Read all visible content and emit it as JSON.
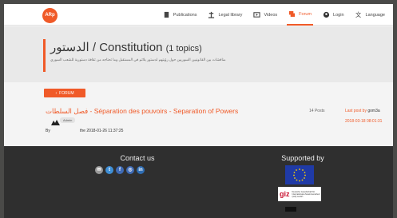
{
  "app": {
    "logo_text": "ARp"
  },
  "nav": {
    "items": [
      {
        "label": "Publications",
        "icon": "book-icon"
      },
      {
        "label": "Legal library",
        "icon": "scales-icon"
      },
      {
        "label": "Videos",
        "icon": "video-icon"
      },
      {
        "label": "Forum",
        "icon": "chat-icon",
        "active": true
      },
      {
        "label": "Login",
        "icon": "user-icon"
      },
      {
        "label": "Language",
        "icon": "translate-icon"
      }
    ]
  },
  "header": {
    "title_ar": "الدستور",
    "title_sep": " / ",
    "title_en": "Constitution",
    "topics": "(1 topics)",
    "subtitle": "مناقشات بين القانونيين السوريين حول رؤيتهم لدستور يلائم في المستقبل وما تحتاجه من ثقافة دستورية للشعب السوري"
  },
  "main": {
    "forum_button": "FORUM",
    "topic": {
      "title": "فصل السلطات - Séparation des pouvoirs - Separation of Powers",
      "role_badge": "Admin",
      "by_label": "By",
      "created": "the 2018-01-26 11:37:25",
      "posts": "14 Posts",
      "last_post_label": "Last post by",
      "last_post_user": "gom3a",
      "last_post_date": "2018-03-18 08:01:31"
    }
  },
  "footer": {
    "contact_title": "Contact us",
    "social": [
      "email-icon",
      "twitter-icon",
      "facebook-icon",
      "instagram-icon",
      "linkedin-icon"
    ],
    "supported_title": "Supported by",
    "giz_word": "giz",
    "giz_caption": "Deutsche Gesellschaft für Internationale Zusammenarbeit (GIZ) GmbH"
  },
  "colors": {
    "accent": "#f05a28",
    "footer_bg": "#2f2f2f",
    "header_bg": "#e9e9e9"
  }
}
